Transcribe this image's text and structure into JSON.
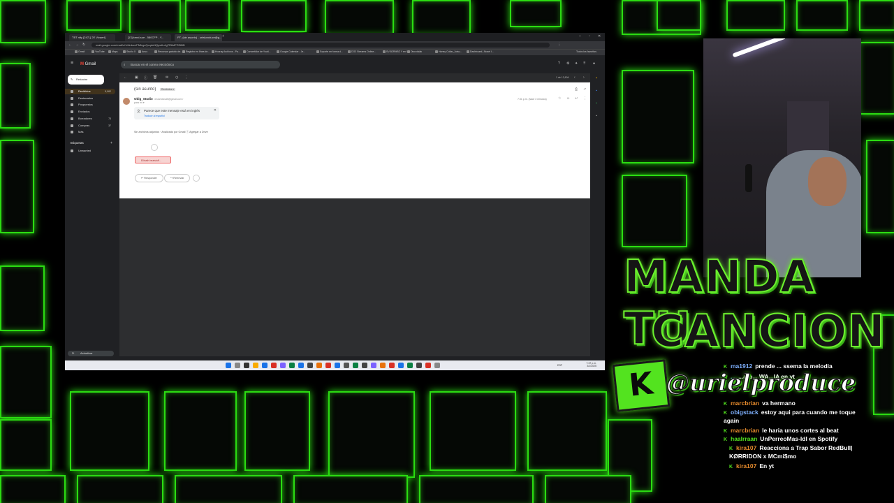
{
  "colors": {
    "neon": "#2bdc12",
    "user_orange": "#e58a2c",
    "user_blue": "#7fb1ff",
    "kick_green": "#53e31f"
  },
  "browser": {
    "tabs": [
      "TBT nfty [247] [ 2E Vivaert]",
      "[13] kend-sue - 580CFP - Y...",
      "PT- (sin asunto) - urielproduce@g..."
    ],
    "url": "mail.google.com/mail/u/1/#inbox/FMfcgzQcqdnNQpwlLcfgTRkMFRZtBD",
    "bookmarks": [
      "Gmail",
      "YouTube",
      "Maps",
      "Studio X",
      "Anuo",
      "Recursos gratuito de...",
      "Registro en lÍnea de...",
      "Hooray Archivos - Pa...",
      "Convertidor de Youtl...",
      "Google Calendar - Je...",
      "Soporte en forma d...",
      "DG3 Streams Online...",
      "SV-B2RMBZ Y en V...",
      "Discotulak",
      "Honey Collar_Jutsu...",
      "Dashboard | Nosel I..."
    ],
    "bookmarks_right": "Todos los favoritos"
  },
  "gmail": {
    "logo": "Gmail",
    "search_placeholder": "Buscar en el correo electrónico",
    "compose": "Redactar",
    "nav": [
      {
        "label": "Recibidos",
        "count": "5,062",
        "active": true
      },
      {
        "label": "Destacados",
        "count": "",
        "active": false
      },
      {
        "label": "Pospuestos",
        "count": "",
        "active": false
      },
      {
        "label": "Enviados",
        "count": "",
        "active": false
      },
      {
        "label": "Borradores",
        "count": "73",
        "active": false
      },
      {
        "label": "Compras",
        "count": "37",
        "active": false
      },
      {
        "label": "Más",
        "count": "",
        "active": false
      }
    ],
    "labels_header": "Etiquetas",
    "labels": [
      "Unwanted"
    ],
    "update_label": "Actualizar",
    "pager": "1 de 12,604",
    "subject": "(sin asunto)",
    "badge": "Recibidos x",
    "sender_name": "Obig_Studio",
    "sender_email": "<estumessd5@gmail.com>",
    "to_line": "para mí ▾",
    "date": "7:31 p.m. (hace 3 minutos)",
    "translate_line1": "Parece que este mensaje está en inglés",
    "translate_line2": "Traducir al español",
    "attach_line": "Sin archivos adjuntos · Analizado por Gmail ⓘ    Agregar a Drive",
    "file_chip": "Ellinath beatstuff...",
    "reply": "Responder",
    "forward": "Reenviar"
  },
  "taskbar": {
    "clock_time": "7:37 p.m.",
    "clock_date": "3/1/2025",
    "lang": "ESP"
  },
  "overlay": {
    "promo_line1": "MANDA TU",
    "promo_line2": "CANCION",
    "kick_logo": "K",
    "handle": "@urielproduce"
  },
  "chat": [
    {
      "user": "ma1912",
      "text": "prende ... ssema la melodia",
      "color": "user_blue"
    },
    {
      "user": "...",
      "text": "...aro... WA...IA en yt",
      "color": "user_blue"
    },
    {
      "user": "marcbrian",
      "text": "va hermano",
      "color": "user_orange"
    },
    {
      "user": "obigstack",
      "text": "estoy aqui para cuando me toque again",
      "color": "user_blue"
    },
    {
      "user": "marcbrian",
      "text": "le haria unos cortes al beat",
      "color": "user_orange"
    },
    {
      "user": "haalrraan",
      "text": "UnPerreoMas-Idl en Spotify",
      "color": "kick_green"
    },
    {
      "user": "kira107",
      "text": "Reacciona a Trap Sabor RedBull| KØRRIDON x MCmi$mo",
      "color": "user_orange"
    },
    {
      "user": "kira107",
      "text": "En yt",
      "color": "user_orange"
    }
  ]
}
